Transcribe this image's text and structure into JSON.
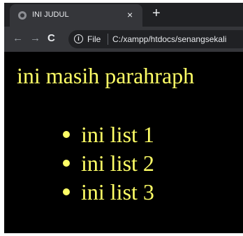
{
  "browser": {
    "tab": {
      "title": "INI JUDUL",
      "close_icon": "×",
      "favicon": "globe-icon"
    },
    "new_tab_icon": "+",
    "toolbar": {
      "back_icon": "←",
      "forward_icon": "→",
      "reload_icon": "C",
      "info_icon": "i",
      "file_label": "File",
      "url": "C:/xampp/htdocs/senangsekali"
    }
  },
  "page": {
    "paragraph": "ini masih parahraph",
    "list_items": [
      "ini list 1",
      "ini list 2",
      "ini list 3"
    ],
    "colors": {
      "background": "#000000",
      "text": "#ffff66"
    }
  }
}
